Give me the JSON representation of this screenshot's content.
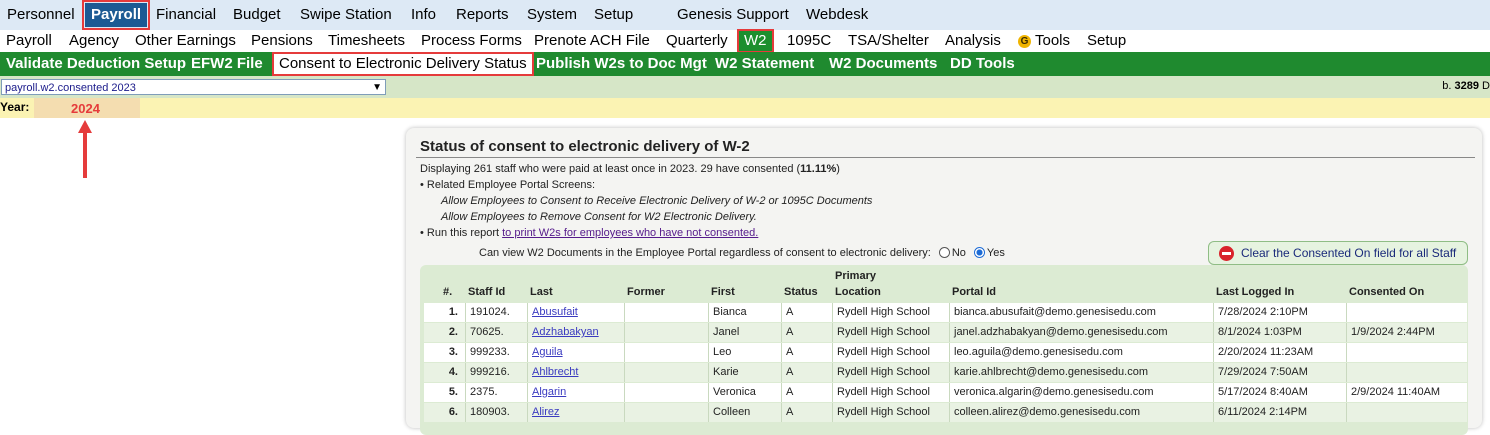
{
  "nav_primary": [
    "Personnel",
    "Payroll",
    "Financial",
    "Budget",
    "Swipe Station",
    "Info",
    "Reports",
    "System",
    "Setup",
    "Genesis Support",
    "Webdesk"
  ],
  "nav_secondary": [
    "Payroll",
    "Agency",
    "Other Earnings",
    "Pensions",
    "Timesheets",
    "Process Forms",
    "Prenote ACH File",
    "Quarterly",
    "W2",
    "1095C",
    "TSA/Shelter",
    "Analysis",
    "Tools",
    "Setup"
  ],
  "nav_w2": [
    "Validate Deduction Setup",
    "EFW2 File",
    "Consent to Electronic Delivery Status",
    "Publish W2s to Doc Mgt",
    "W2 Statement",
    "W2 Documents",
    "DD Tools"
  ],
  "active": {
    "primary": "Payroll",
    "secondary": "W2",
    "w2": "Consent to Electronic Delivery Status"
  },
  "report_select": "payroll.w2.consented 2023",
  "build_prefix": "b.",
  "build_number": "3289",
  "year_label": "Year:",
  "year_value": "2024",
  "panel": {
    "title": "Status of consent to electronic delivery of W-2",
    "summary_prefix": "Displaying 261 staff who were paid at least once in 2023.     29 have consented (",
    "summary_pct": "11.11%",
    "summary_suffix": ")",
    "related_label": "• Related Employee Portal Screens:",
    "related_1": "Allow Employees to Consent to Receive Electronic Delivery of W-2 or 1095C Documents",
    "related_2": "Allow Employees to Remove Consent for W2 Electronic Delivery.",
    "run_prefix": "• Run this report ",
    "run_link": "to print W2s for employees who have not consented.",
    "view_question": "Can view W2 Documents in the Employee Portal regardless of consent to electronic delivery:",
    "option_no": "No",
    "option_yes": "Yes",
    "selected_option": "Yes",
    "clear_button": "Clear the Consented On field for all Staff"
  },
  "table": {
    "headers": {
      "num": "#.",
      "staff_id": "Staff Id",
      "last": "Last",
      "former": "Former",
      "first": "First",
      "status": "Status",
      "primary": "Primary",
      "location": "Location",
      "portal": "Portal Id",
      "last_logged": "Last Logged In",
      "consented": "Consented On"
    },
    "rows": [
      {
        "num": "1.",
        "staff_id": "191024.",
        "last": "Abusufait",
        "former": "",
        "first": "Bianca",
        "status": "A",
        "location": "Rydell High School",
        "portal": "bianca.abusufait@demo.genesisedu.com",
        "last_logged": "7/28/2024 2:10PM",
        "consented": ""
      },
      {
        "num": "2.",
        "staff_id": "70625.",
        "last": "Adzhabakyan",
        "former": "",
        "first": "Janel",
        "status": "A",
        "location": "Rydell High School",
        "portal": "janel.adzhabakyan@demo.genesisedu.com",
        "last_logged": "8/1/2024 1:03PM",
        "consented": "1/9/2024 2:44PM"
      },
      {
        "num": "3.",
        "staff_id": "999233.",
        "last": "Aguila",
        "former": "",
        "first": "Leo",
        "status": "A",
        "location": "Rydell High School",
        "portal": "leo.aguila@demo.genesisedu.com",
        "last_logged": "2/20/2024 11:23AM",
        "consented": ""
      },
      {
        "num": "4.",
        "staff_id": "999216.",
        "last": "Ahlbrecht",
        "former": "",
        "first": "Karie",
        "status": "A",
        "location": "Rydell High School",
        "portal": "karie.ahlbrecht@demo.genesisedu.com",
        "last_logged": "7/29/2024 7:50AM",
        "consented": ""
      },
      {
        "num": "5.",
        "staff_id": "2375.",
        "last": "Algarin",
        "former": "",
        "first": "Veronica",
        "status": "A",
        "location": "Rydell High School",
        "portal": "veronica.algarin@demo.genesisedu.com",
        "last_logged": "5/17/2024 8:40AM",
        "consented": "2/9/2024 11:40AM"
      },
      {
        "num": "6.",
        "staff_id": "180903.",
        "last": "Alirez",
        "former": "",
        "first": "Colleen",
        "status": "A",
        "location": "Rydell High School",
        "portal": "colleen.alirez@demo.genesisedu.com",
        "last_logged": "6/11/2024 2:14PM",
        "consented": ""
      }
    ]
  },
  "colors": {
    "nav_active": "#1c5a93",
    "w2_bar": "#1f8a2f",
    "highlight": "#e53b3b",
    "year_bar": "#fbf3b3"
  }
}
